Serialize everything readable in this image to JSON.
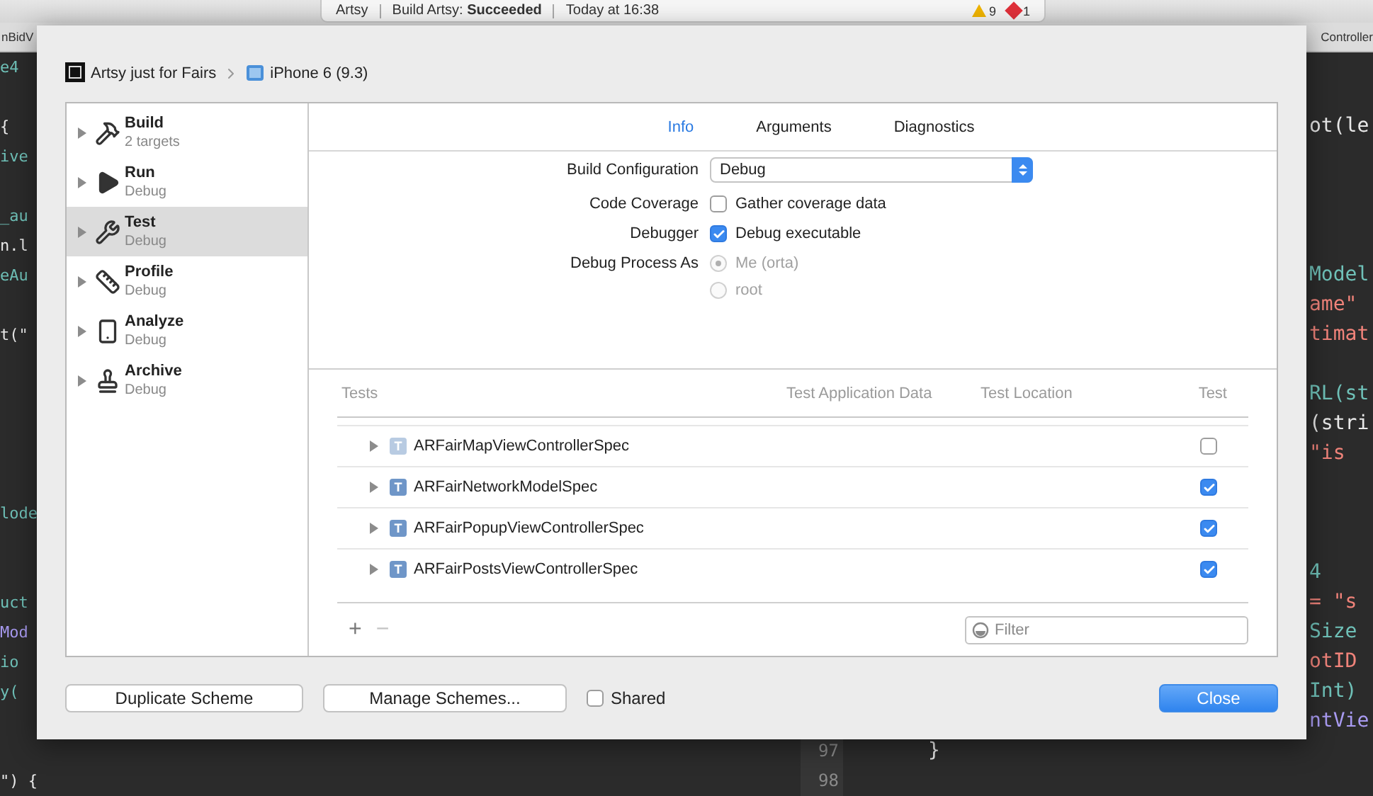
{
  "toolbar": {
    "status": {
      "project": "Artsy",
      "build": "Build Artsy: **Succeeded**",
      "time": "Today at 16:38",
      "warnings": "9",
      "errors": "1"
    }
  },
  "editor_tabs": [
    "nBidV",
    "Controller"
  ],
  "code_left": [
    {
      "text": "e4",
      "kind": "type"
    },
    {
      "text": "{",
      "kind": "plain"
    },
    {
      "text": "ive",
      "kind": "type"
    },
    {
      "text": "_au",
      "kind": "type"
    },
    {
      "text": "n.l",
      "kind": "plain"
    },
    {
      "text": "eAu",
      "kind": "type"
    },
    {
      "text": "t(\"",
      "kind": "plain"
    },
    {
      "text": "lode",
      "kind": "type"
    },
    {
      "text": "uct",
      "kind": "type"
    },
    {
      "text": "Mod",
      "kind": "method"
    },
    {
      "text": "io",
      "kind": "type"
    },
    {
      "text": "y(",
      "kind": "type"
    },
    {
      "text": "\") {",
      "kind": "plain"
    }
  ],
  "code_right": [
    {
      "text": "ot(le",
      "kind": "plain"
    },
    {
      "text": "Model",
      "kind": "type"
    },
    {
      "text": "ame\"",
      "kind": "string"
    },
    {
      "text": "timat",
      "kind": "string"
    },
    {
      "text": "RL(st",
      "kind": "type"
    },
    {
      "text": "(stri",
      "kind": "plain"
    },
    {
      "text": "\"is",
      "kind": "string"
    },
    {
      "text": "4",
      "kind": "type"
    },
    {
      "text": "= \"s",
      "kind": "string"
    },
    {
      "text": "Size",
      "kind": "type"
    },
    {
      "text": "otID",
      "kind": "string"
    },
    {
      "text": "Int)",
      "kind": "type"
    },
    {
      "text": "ntVie",
      "kind": "method"
    }
  ],
  "code_middle": {
    "line_numbers": [
      "97",
      "98"
    ],
    "code": "}"
  },
  "dialog": {
    "breadcrumb": {
      "scheme": "Artsy just for Fairs",
      "destination": "iPhone 6 (9.3)"
    },
    "sidebar": {
      "items": [
        {
          "kind": "build",
          "title": "Build",
          "subtitle": "2 targets",
          "selected": false
        },
        {
          "kind": "run",
          "title": "Run",
          "subtitle": "Debug",
          "selected": false
        },
        {
          "kind": "test",
          "title": "Test",
          "subtitle": "Debug",
          "selected": true
        },
        {
          "kind": "profile",
          "title": "Profile",
          "subtitle": "Debug",
          "selected": false
        },
        {
          "kind": "analyze",
          "title": "Analyze",
          "subtitle": "Debug",
          "selected": false
        },
        {
          "kind": "archive",
          "title": "Archive",
          "subtitle": "Debug",
          "selected": false
        }
      ]
    },
    "tabs": [
      {
        "label": "Info",
        "selected": true
      },
      {
        "label": "Arguments",
        "selected": false
      },
      {
        "label": "Diagnostics",
        "selected": false
      }
    ],
    "form": {
      "build_configuration": {
        "label": "Build Configuration",
        "value": "Debug"
      },
      "code_coverage": {
        "label": "Code Coverage",
        "option": "Gather coverage data",
        "checked": false
      },
      "debugger": {
        "label": "Debugger",
        "option": "Debug executable",
        "checked": true
      },
      "debug_process_as": {
        "label": "Debug Process As",
        "disabled": true,
        "options": [
          {
            "label": "Me (orta)",
            "selected": true
          },
          {
            "label": "root",
            "selected": false
          }
        ]
      }
    },
    "tests": {
      "columns": [
        "Tests",
        "Test Application Data",
        "Test Location",
        "Test"
      ],
      "rows": [
        {
          "icon": "T",
          "name": "ARFairMapViewControllerSpec",
          "checked": false
        },
        {
          "icon": "T",
          "name": "ARFairNetworkModelSpec",
          "checked": true
        },
        {
          "icon": "T",
          "name": "ARFairPopupViewControllerSpec",
          "checked": true
        },
        {
          "icon": "T",
          "name": "ARFairPostsViewControllerSpec",
          "checked": true
        }
      ],
      "add": "+",
      "remove": "−",
      "filter": {
        "placeholder": "Filter"
      }
    },
    "footer": {
      "duplicate": "Duplicate Scheme",
      "manage": "Manage Schemes...",
      "shared": {
        "label": "Shared",
        "checked": false
      },
      "close": "Close"
    }
  }
}
